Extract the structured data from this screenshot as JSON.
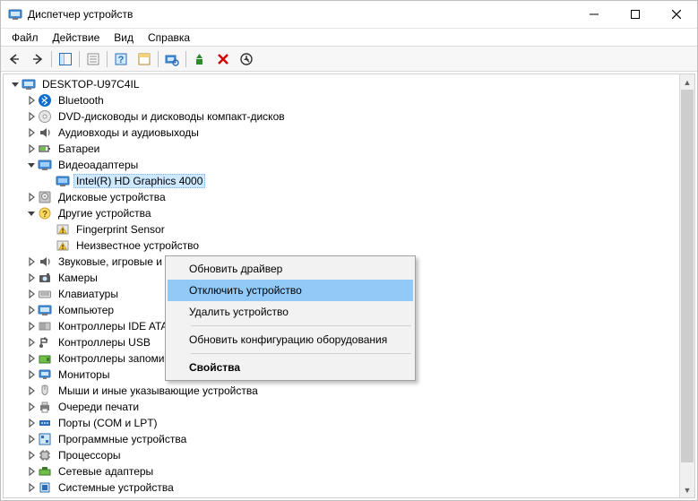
{
  "title": "Диспетчер устройств",
  "menus": {
    "file": "Файл",
    "action": "Действие",
    "view": "Вид",
    "help": "Справка"
  },
  "root": "DESKTOP-U97C4IL",
  "categories": [
    {
      "key": "bluetooth",
      "label": "Bluetooth",
      "expanded": false,
      "icon": "bluetooth"
    },
    {
      "key": "dvd",
      "label": "DVD-дисководы и дисководы компакт-дисков",
      "expanded": false,
      "icon": "dvd"
    },
    {
      "key": "audio",
      "label": "Аудиовходы и аудиовыходы",
      "expanded": false,
      "icon": "audio"
    },
    {
      "key": "battery",
      "label": "Батареи",
      "expanded": false,
      "icon": "battery"
    },
    {
      "key": "display",
      "label": "Видеоадаптеры",
      "expanded": true,
      "icon": "display",
      "children": [
        {
          "label": "Intel(R) HD Graphics 4000",
          "icon": "display",
          "selected": true
        }
      ]
    },
    {
      "key": "disks",
      "label": "Дисковые устройства",
      "expanded": false,
      "icon": "disk",
      "partial": true
    },
    {
      "key": "other",
      "label": "Другие устройства",
      "expanded": true,
      "icon": "other",
      "children": [
        {
          "label": "Fingerprint Sensor",
          "icon": "warning",
          "partial": true
        },
        {
          "label": "Неизвестное устройство",
          "icon": "warning",
          "partial": true
        }
      ]
    },
    {
      "key": "sound",
      "label": "Звуковые, игровые и видеоустройства",
      "expanded": false,
      "icon": "audio",
      "partial": true
    },
    {
      "key": "cameras",
      "label": "Камеры",
      "expanded": false,
      "icon": "camera"
    },
    {
      "key": "keyboards",
      "label": "Клавиатуры",
      "expanded": false,
      "icon": "keyboard"
    },
    {
      "key": "computer",
      "label": "Компьютер",
      "expanded": false,
      "icon": "computer"
    },
    {
      "key": "ide",
      "label": "Контроллеры IDE ATA/ATAPI",
      "expanded": false,
      "icon": "ide"
    },
    {
      "key": "usb",
      "label": "Контроллеры USB",
      "expanded": false,
      "icon": "usb"
    },
    {
      "key": "storage",
      "label": "Контроллеры запоминающих устройств",
      "expanded": false,
      "icon": "storage"
    },
    {
      "key": "monitors",
      "label": "Мониторы",
      "expanded": false,
      "icon": "monitor"
    },
    {
      "key": "mice",
      "label": "Мыши и иные указывающие устройства",
      "expanded": false,
      "icon": "mouse"
    },
    {
      "key": "printq",
      "label": "Очереди печати",
      "expanded": false,
      "icon": "printer"
    },
    {
      "key": "ports",
      "label": "Порты (COM и LPT)",
      "expanded": false,
      "icon": "port"
    },
    {
      "key": "software",
      "label": "Программные устройства",
      "expanded": false,
      "icon": "software"
    },
    {
      "key": "cpu",
      "label": "Процессоры",
      "expanded": false,
      "icon": "cpu"
    },
    {
      "key": "network",
      "label": "Сетевые адаптеры",
      "expanded": false,
      "icon": "network"
    },
    {
      "key": "system",
      "label": "Системные устройства",
      "expanded": false,
      "icon": "system",
      "partial": true
    }
  ],
  "context_menu": [
    {
      "type": "item",
      "label": "Обновить драйвер"
    },
    {
      "type": "item",
      "label": "Отключить устройство",
      "highlight": true
    },
    {
      "type": "item",
      "label": "Удалить устройство"
    },
    {
      "type": "sep"
    },
    {
      "type": "item",
      "label": "Обновить конфигурацию оборудования"
    },
    {
      "type": "sep"
    },
    {
      "type": "item",
      "label": "Свойства",
      "bold": true
    }
  ]
}
